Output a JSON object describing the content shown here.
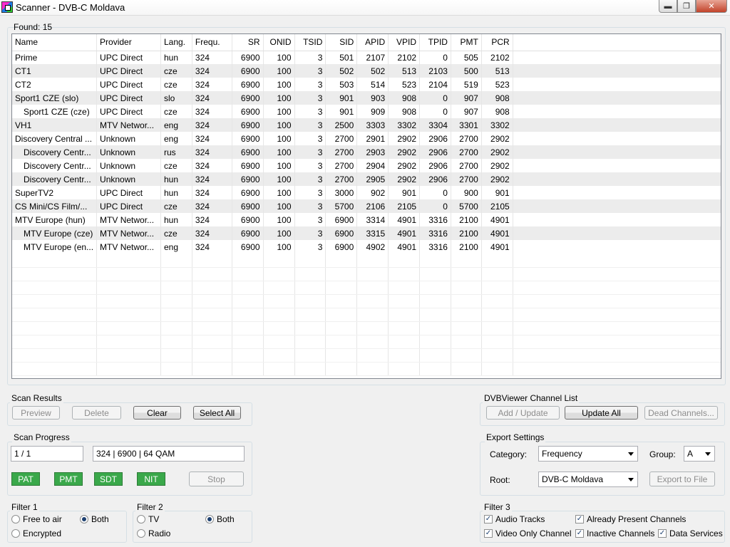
{
  "window": {
    "title": "Scanner - DVB-C Moldava",
    "icons": {
      "app": "app-icon",
      "minimize": "minimize-icon",
      "maximize": "maximize-icon",
      "close": "close-icon"
    }
  },
  "found": {
    "label": "Found:",
    "count": "15"
  },
  "table": {
    "columns": [
      "Name",
      "Provider",
      "Lang.",
      "Frequ.",
      "SR",
      "ONID",
      "TSID",
      "SID",
      "APID",
      "VPID",
      "TPID",
      "PMT",
      "PCR"
    ],
    "rows": [
      [
        "Prime",
        "UPC Direct",
        "hun",
        "324",
        "6900",
        "100",
        "3",
        "501",
        "2107",
        "2102",
        "0",
        "505",
        "2102"
      ],
      [
        "CT1",
        "UPC Direct",
        "cze",
        "324",
        "6900",
        "100",
        "3",
        "502",
        "502",
        "513",
        "2103",
        "500",
        "513"
      ],
      [
        "CT2",
        "UPC Direct",
        "cze",
        "324",
        "6900",
        "100",
        "3",
        "503",
        "514",
        "523",
        "2104",
        "519",
        "523"
      ],
      [
        "Sport1 CZE (slo)",
        "UPC Direct",
        "slo",
        "324",
        "6900",
        "100",
        "3",
        "901",
        "903",
        "908",
        "0",
        "907",
        "908"
      ],
      [
        "Sport1 CZE (cze)",
        "UPC Direct",
        "cze",
        "324",
        "6900",
        "100",
        "3",
        "901",
        "909",
        "908",
        "0",
        "907",
        "908"
      ],
      [
        "VH1",
        "MTV Networ...",
        "eng",
        "324",
        "6900",
        "100",
        "3",
        "2500",
        "3303",
        "3302",
        "3304",
        "3301",
        "3302"
      ],
      [
        "Discovery Central ...",
        "Unknown",
        "eng",
        "324",
        "6900",
        "100",
        "3",
        "2700",
        "2901",
        "2902",
        "2906",
        "2700",
        "2902"
      ],
      [
        "Discovery Centr...",
        "Unknown",
        "rus",
        "324",
        "6900",
        "100",
        "3",
        "2700",
        "2903",
        "2902",
        "2906",
        "2700",
        "2902"
      ],
      [
        "Discovery Centr...",
        "Unknown",
        "cze",
        "324",
        "6900",
        "100",
        "3",
        "2700",
        "2904",
        "2902",
        "2906",
        "2700",
        "2902"
      ],
      [
        "Discovery Centr...",
        "Unknown",
        "hun",
        "324",
        "6900",
        "100",
        "3",
        "2700",
        "2905",
        "2902",
        "2906",
        "2700",
        "2902"
      ],
      [
        "SuperTV2",
        "UPC Direct",
        "hun",
        "324",
        "6900",
        "100",
        "3",
        "3000",
        "902",
        "901",
        "0",
        "900",
        "901"
      ],
      [
        "CS Mini/CS Film/...",
        "UPC Direct",
        "cze",
        "324",
        "6900",
        "100",
        "3",
        "5700",
        "2106",
        "2105",
        "0",
        "5700",
        "2105"
      ],
      [
        "MTV Europe (hun)",
        "MTV Networ...",
        "hun",
        "324",
        "6900",
        "100",
        "3",
        "6900",
        "3314",
        "4901",
        "3316",
        "2100",
        "4901"
      ],
      [
        "MTV Europe (cze)",
        "MTV Networ...",
        "cze",
        "324",
        "6900",
        "100",
        "3",
        "6900",
        "3315",
        "4901",
        "3316",
        "2100",
        "4901"
      ],
      [
        "MTV Europe (en...",
        "MTV Networ...",
        "eng",
        "324",
        "6900",
        "100",
        "3",
        "6900",
        "4902",
        "4901",
        "3316",
        "2100",
        "4901"
      ]
    ],
    "indented": [
      4,
      7,
      8,
      9,
      13,
      14
    ]
  },
  "scan_results": {
    "title": "Scan Results",
    "preview": "Preview",
    "delete": "Delete",
    "clear": "Clear",
    "select_all": "Select All"
  },
  "channel_list": {
    "title": "DVBViewer Channel List",
    "add_update": "Add / Update",
    "update_all": "Update All",
    "dead_channels": "Dead Channels..."
  },
  "scan_progress": {
    "title": "Scan Progress",
    "progress": "1 / 1",
    "transponder": "324 | 6900 | 64 QAM",
    "pat": "PAT",
    "pmt": "PMT",
    "sdt": "SDT",
    "nit": "NIT",
    "stop": "Stop"
  },
  "export": {
    "title": "Export Settings",
    "category_label": "Category:",
    "category_value": "Frequency",
    "group_label": "Group:",
    "group_value": "A",
    "root_label": "Root:",
    "root_value": "DVB-C Moldava",
    "export_button": "Export to File"
  },
  "filter1": {
    "title": "Filter 1",
    "free_to_air": "Free to air",
    "both": "Both",
    "encrypted": "Encrypted"
  },
  "filter2": {
    "title": "Filter 2",
    "tv": "TV",
    "both": "Both",
    "radio": "Radio"
  },
  "filter3": {
    "title": "Filter 3",
    "audio_tracks": "Audio Tracks",
    "already_present": "Already Present Channels",
    "video_only": "Video Only Channel",
    "inactive": "Inactive Channels",
    "data_services": "Data Services"
  }
}
